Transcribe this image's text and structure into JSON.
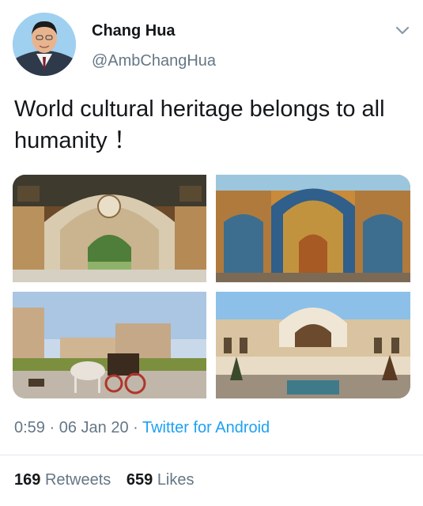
{
  "author": {
    "name": "Chang Hua",
    "handle": "@AmbChangHua"
  },
  "tweet": {
    "text": "World cultural heritage belongs to all humanity ！"
  },
  "meta": {
    "time": "0:59",
    "separator": " · ",
    "date": "06 Jan 20",
    "source": "Twitter for Android"
  },
  "stats": {
    "retweets_count": "169",
    "retweets_label": "Retweets",
    "likes_count": "659",
    "likes_label": "Likes"
  },
  "colors": {
    "text": "#14171a",
    "secondary": "#657786",
    "link": "#1da1f2",
    "divider": "#e1e8ed"
  },
  "icons": {
    "menu": "chevron-down-icon"
  }
}
